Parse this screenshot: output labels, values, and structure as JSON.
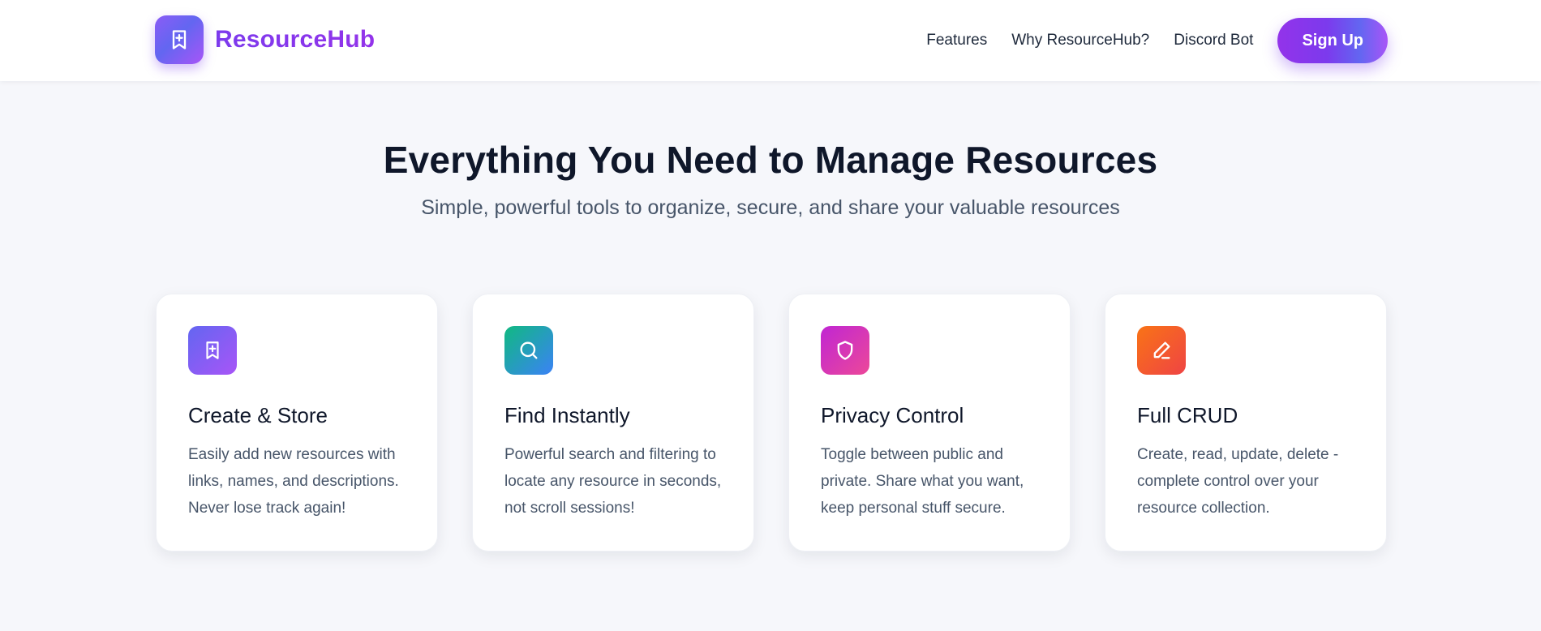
{
  "brand": {
    "name": "ResourceHub",
    "logo_icon": "bookmark-plus-icon",
    "accent": "#7c3aed"
  },
  "nav": {
    "links": [
      "Features",
      "Why ResourceHub?",
      "Discord Bot"
    ],
    "signup_label": "Sign Up"
  },
  "hero": {
    "title": "Everything You Need to Manage Resources",
    "subtitle": "Simple, powerful tools to organize, secure, and share your valuable resources"
  },
  "features": [
    {
      "title": "Create & Store",
      "description": "Easily add new resources with links, names, and descriptions. Never lose track again!",
      "icon": "bookmark-plus-icon",
      "gradient": [
        "#6366f1",
        "#a855f7"
      ]
    },
    {
      "title": "Find Instantly",
      "description": "Powerful search and filtering to locate any resource in seconds, not scroll sessions!",
      "icon": "search-icon",
      "gradient": [
        "#10b981",
        "#3b82f6"
      ]
    },
    {
      "title": "Privacy Control",
      "description": "Toggle between public and private. Share what you want, keep personal stuff secure.",
      "icon": "shield-icon",
      "gradient": [
        "#c026d3",
        "#ec4899"
      ]
    },
    {
      "title": "Full CRUD",
      "description": "Create, read, update, delete - complete control over your resource collection.",
      "icon": "pencil-icon",
      "gradient": [
        "#f97316",
        "#ef4444"
      ]
    }
  ]
}
